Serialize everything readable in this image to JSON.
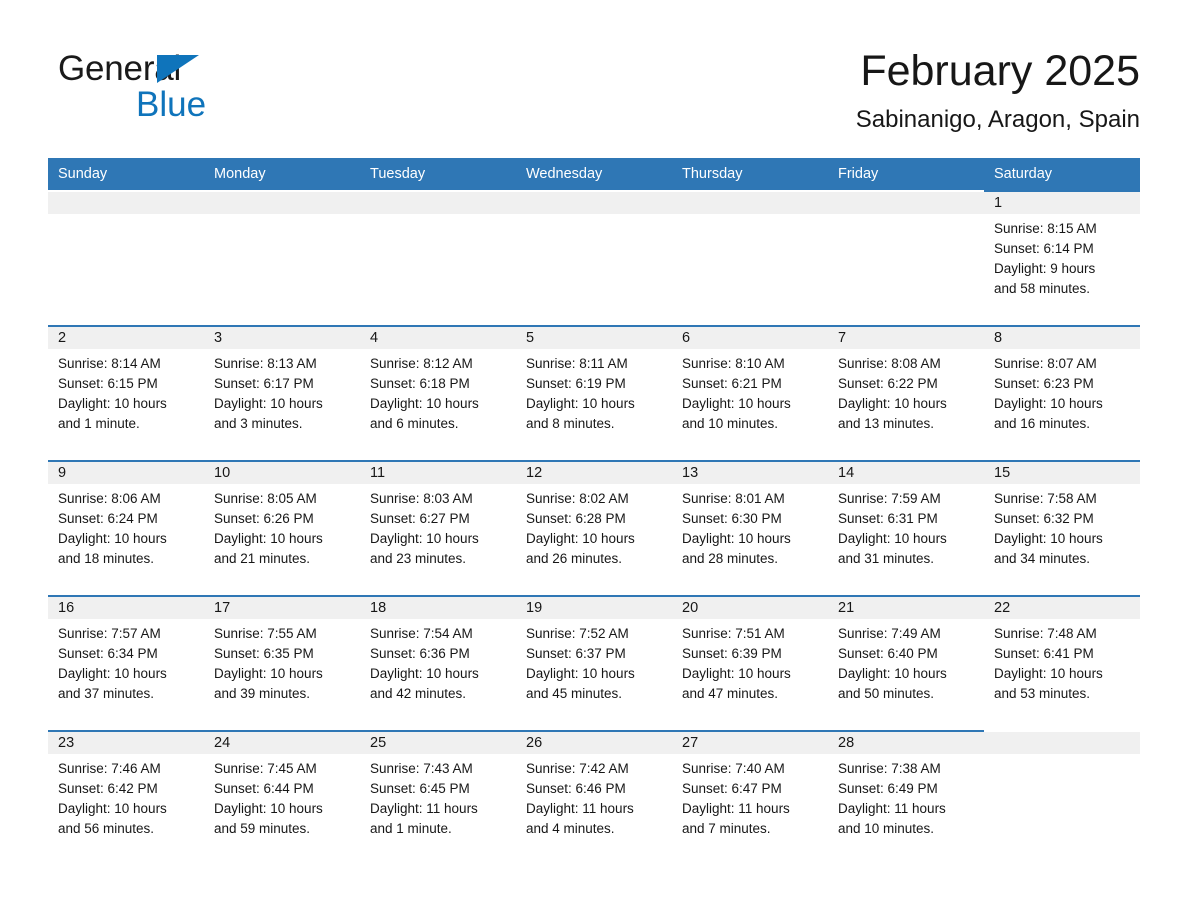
{
  "brand": {
    "name_part1": "General",
    "name_part2": "Blue",
    "triangle_color": "#0f74bb"
  },
  "header": {
    "title": "February 2025",
    "subtitle": "Sabinanigo, Aragon, Spain"
  },
  "theme": {
    "header_blue": "#2f77b5",
    "daynum_band": "#f0f0f0",
    "text": "#171717"
  },
  "weekday_headers": [
    "Sunday",
    "Monday",
    "Tuesday",
    "Wednesday",
    "Thursday",
    "Friday",
    "Saturday"
  ],
  "weeks": [
    [
      {
        "day": "",
        "sunrise": "",
        "sunset": "",
        "daylight1": "",
        "daylight2": "",
        "empty": true
      },
      {
        "day": "",
        "sunrise": "",
        "sunset": "",
        "daylight1": "",
        "daylight2": "",
        "empty": true
      },
      {
        "day": "",
        "sunrise": "",
        "sunset": "",
        "daylight1": "",
        "daylight2": "",
        "empty": true
      },
      {
        "day": "",
        "sunrise": "",
        "sunset": "",
        "daylight1": "",
        "daylight2": "",
        "empty": true
      },
      {
        "day": "",
        "sunrise": "",
        "sunset": "",
        "daylight1": "",
        "daylight2": "",
        "empty": true
      },
      {
        "day": "",
        "sunrise": "",
        "sunset": "",
        "daylight1": "",
        "daylight2": "",
        "empty": true
      },
      {
        "day": "1",
        "sunrise": "Sunrise: 8:15 AM",
        "sunset": "Sunset: 6:14 PM",
        "daylight1": "Daylight: 9 hours",
        "daylight2": "and 58 minutes.",
        "empty": false
      }
    ],
    [
      {
        "day": "2",
        "sunrise": "Sunrise: 8:14 AM",
        "sunset": "Sunset: 6:15 PM",
        "daylight1": "Daylight: 10 hours",
        "daylight2": "and 1 minute.",
        "empty": false
      },
      {
        "day": "3",
        "sunrise": "Sunrise: 8:13 AM",
        "sunset": "Sunset: 6:17 PM",
        "daylight1": "Daylight: 10 hours",
        "daylight2": "and 3 minutes.",
        "empty": false
      },
      {
        "day": "4",
        "sunrise": "Sunrise: 8:12 AM",
        "sunset": "Sunset: 6:18 PM",
        "daylight1": "Daylight: 10 hours",
        "daylight2": "and 6 minutes.",
        "empty": false
      },
      {
        "day": "5",
        "sunrise": "Sunrise: 8:11 AM",
        "sunset": "Sunset: 6:19 PM",
        "daylight1": "Daylight: 10 hours",
        "daylight2": "and 8 minutes.",
        "empty": false
      },
      {
        "day": "6",
        "sunrise": "Sunrise: 8:10 AM",
        "sunset": "Sunset: 6:21 PM",
        "daylight1": "Daylight: 10 hours",
        "daylight2": "and 10 minutes.",
        "empty": false
      },
      {
        "day": "7",
        "sunrise": "Sunrise: 8:08 AM",
        "sunset": "Sunset: 6:22 PM",
        "daylight1": "Daylight: 10 hours",
        "daylight2": "and 13 minutes.",
        "empty": false
      },
      {
        "day": "8",
        "sunrise": "Sunrise: 8:07 AM",
        "sunset": "Sunset: 6:23 PM",
        "daylight1": "Daylight: 10 hours",
        "daylight2": "and 16 minutes.",
        "empty": false
      }
    ],
    [
      {
        "day": "9",
        "sunrise": "Sunrise: 8:06 AM",
        "sunset": "Sunset: 6:24 PM",
        "daylight1": "Daylight: 10 hours",
        "daylight2": "and 18 minutes.",
        "empty": false
      },
      {
        "day": "10",
        "sunrise": "Sunrise: 8:05 AM",
        "sunset": "Sunset: 6:26 PM",
        "daylight1": "Daylight: 10 hours",
        "daylight2": "and 21 minutes.",
        "empty": false
      },
      {
        "day": "11",
        "sunrise": "Sunrise: 8:03 AM",
        "sunset": "Sunset: 6:27 PM",
        "daylight1": "Daylight: 10 hours",
        "daylight2": "and 23 minutes.",
        "empty": false
      },
      {
        "day": "12",
        "sunrise": "Sunrise: 8:02 AM",
        "sunset": "Sunset: 6:28 PM",
        "daylight1": "Daylight: 10 hours",
        "daylight2": "and 26 minutes.",
        "empty": false
      },
      {
        "day": "13",
        "sunrise": "Sunrise: 8:01 AM",
        "sunset": "Sunset: 6:30 PM",
        "daylight1": "Daylight: 10 hours",
        "daylight2": "and 28 minutes.",
        "empty": false
      },
      {
        "day": "14",
        "sunrise": "Sunrise: 7:59 AM",
        "sunset": "Sunset: 6:31 PM",
        "daylight1": "Daylight: 10 hours",
        "daylight2": "and 31 minutes.",
        "empty": false
      },
      {
        "day": "15",
        "sunrise": "Sunrise: 7:58 AM",
        "sunset": "Sunset: 6:32 PM",
        "daylight1": "Daylight: 10 hours",
        "daylight2": "and 34 minutes.",
        "empty": false
      }
    ],
    [
      {
        "day": "16",
        "sunrise": "Sunrise: 7:57 AM",
        "sunset": "Sunset: 6:34 PM",
        "daylight1": "Daylight: 10 hours",
        "daylight2": "and 37 minutes.",
        "empty": false
      },
      {
        "day": "17",
        "sunrise": "Sunrise: 7:55 AM",
        "sunset": "Sunset: 6:35 PM",
        "daylight1": "Daylight: 10 hours",
        "daylight2": "and 39 minutes.",
        "empty": false
      },
      {
        "day": "18",
        "sunrise": "Sunrise: 7:54 AM",
        "sunset": "Sunset: 6:36 PM",
        "daylight1": "Daylight: 10 hours",
        "daylight2": "and 42 minutes.",
        "empty": false
      },
      {
        "day": "19",
        "sunrise": "Sunrise: 7:52 AM",
        "sunset": "Sunset: 6:37 PM",
        "daylight1": "Daylight: 10 hours",
        "daylight2": "and 45 minutes.",
        "empty": false
      },
      {
        "day": "20",
        "sunrise": "Sunrise: 7:51 AM",
        "sunset": "Sunset: 6:39 PM",
        "daylight1": "Daylight: 10 hours",
        "daylight2": "and 47 minutes.",
        "empty": false
      },
      {
        "day": "21",
        "sunrise": "Sunrise: 7:49 AM",
        "sunset": "Sunset: 6:40 PM",
        "daylight1": "Daylight: 10 hours",
        "daylight2": "and 50 minutes.",
        "empty": false
      },
      {
        "day": "22",
        "sunrise": "Sunrise: 7:48 AM",
        "sunset": "Sunset: 6:41 PM",
        "daylight1": "Daylight: 10 hours",
        "daylight2": "and 53 minutes.",
        "empty": false
      }
    ],
    [
      {
        "day": "23",
        "sunrise": "Sunrise: 7:46 AM",
        "sunset": "Sunset: 6:42 PM",
        "daylight1": "Daylight: 10 hours",
        "daylight2": "and 56 minutes.",
        "empty": false
      },
      {
        "day": "24",
        "sunrise": "Sunrise: 7:45 AM",
        "sunset": "Sunset: 6:44 PM",
        "daylight1": "Daylight: 10 hours",
        "daylight2": "and 59 minutes.",
        "empty": false
      },
      {
        "day": "25",
        "sunrise": "Sunrise: 7:43 AM",
        "sunset": "Sunset: 6:45 PM",
        "daylight1": "Daylight: 11 hours",
        "daylight2": "and 1 minute.",
        "empty": false
      },
      {
        "day": "26",
        "sunrise": "Sunrise: 7:42 AM",
        "sunset": "Sunset: 6:46 PM",
        "daylight1": "Daylight: 11 hours",
        "daylight2": "and 4 minutes.",
        "empty": false
      },
      {
        "day": "27",
        "sunrise": "Sunrise: 7:40 AM",
        "sunset": "Sunset: 6:47 PM",
        "daylight1": "Daylight: 11 hours",
        "daylight2": "and 7 minutes.",
        "empty": false
      },
      {
        "day": "28",
        "sunrise": "Sunrise: 7:38 AM",
        "sunset": "Sunset: 6:49 PM",
        "daylight1": "Daylight: 11 hours",
        "daylight2": "and 10 minutes.",
        "empty": false
      },
      {
        "day": "",
        "sunrise": "",
        "sunset": "",
        "daylight1": "",
        "daylight2": "",
        "empty": true
      }
    ]
  ]
}
